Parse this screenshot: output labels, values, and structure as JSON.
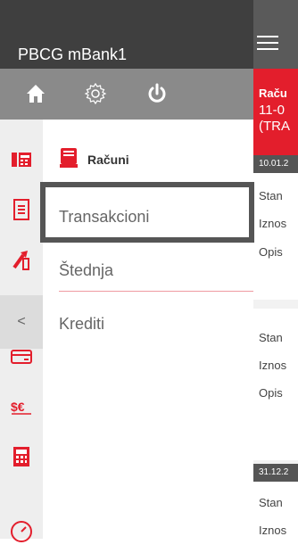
{
  "app": {
    "title": "PBCG mBank1"
  },
  "drawer": {
    "header_icons": [
      "home-icon",
      "gear-icon",
      "power-icon"
    ],
    "rail_icons": [
      "accounts-icon",
      "transactions-doc-icon",
      "savings-icon",
      "collapse-icon",
      "card-icon",
      "currency-exchange-icon",
      "calculator-icon",
      "gauge-icon"
    ],
    "collapse_glyph": "<",
    "section_title": "Računi",
    "items": [
      {
        "label": "Transakcioni"
      },
      {
        "label": "Štednja"
      },
      {
        "label": "Krediti"
      }
    ]
  },
  "background": {
    "account_title": "Raču",
    "account_number": "11-0",
    "account_type": "(TRA",
    "groups": [
      {
        "date": "10.01.2",
        "lines": [
          "Stan",
          "Iznos",
          "Opis"
        ]
      },
      {
        "date": "",
        "lines": [
          "Stan",
          "Iznos",
          "Opis"
        ]
      },
      {
        "date": "31.12.2",
        "lines": [
          "Stan",
          "Iznos"
        ]
      }
    ]
  },
  "colors": {
    "brand_red": "#e31e2c",
    "header_dark": "#3f3f3f",
    "header_gray": "#8a8a8a",
    "accent_line": "#ef9aa1"
  }
}
